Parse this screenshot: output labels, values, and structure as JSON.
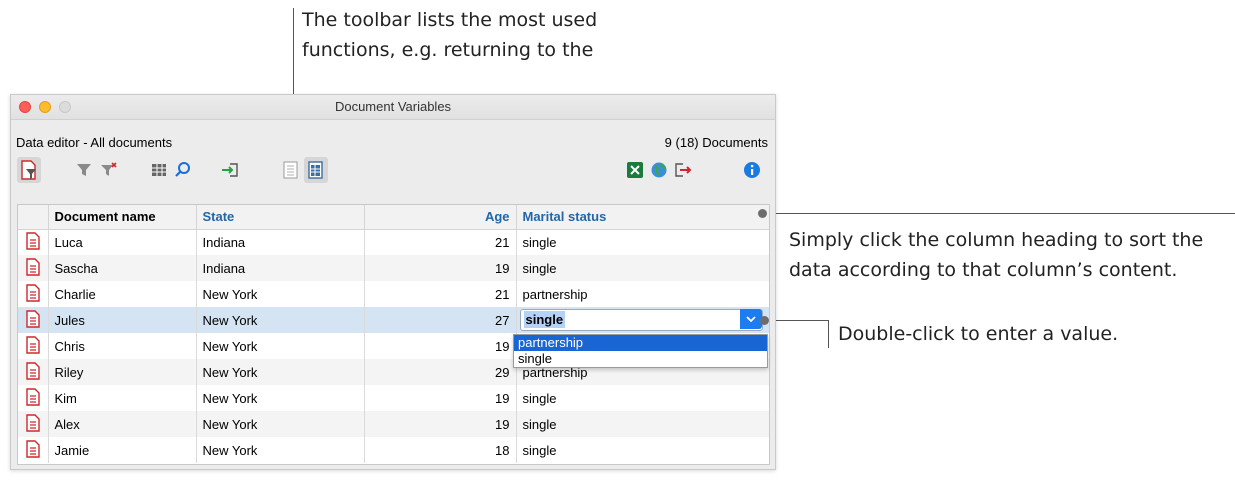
{
  "callouts": {
    "toolbar_line1": "The toolbar lists the most used",
    "toolbar_line2": "functions, e.g. returning to the",
    "sort_line1": "Simply click the column heading to sort the",
    "sort_line2": "data according to that column’s content.",
    "double_click": "Double-click to enter a value."
  },
  "window": {
    "title": "Document Variables",
    "info_left": "Data editor - All documents",
    "info_right": "9 (18) Documents"
  },
  "toolbar": {
    "icons": [
      "filter-document-icon",
      "filter-icon",
      "clear-filter-icon",
      "columns-icon",
      "search-icon",
      "import-icon",
      "list-view-icon",
      "table-view-icon",
      "excel-export-icon",
      "web-export-icon",
      "export-icon",
      "info-icon"
    ]
  },
  "table": {
    "headers": {
      "name": "Document name",
      "state": "State",
      "age": "Age",
      "marital": "Marital status"
    },
    "rows": [
      {
        "name": "Luca",
        "state": "Indiana",
        "age": "21",
        "marital": "single"
      },
      {
        "name": "Sascha",
        "state": "Indiana",
        "age": "19",
        "marital": "single"
      },
      {
        "name": "Charlie",
        "state": "New York",
        "age": "21",
        "marital": "partnership"
      },
      {
        "name": "Jules",
        "state": "New York",
        "age": "27",
        "marital": "single"
      },
      {
        "name": "Chris",
        "state": "New York",
        "age": "19",
        "marital": ""
      },
      {
        "name": "Riley",
        "state": "New York",
        "age": "29",
        "marital": "partnership"
      },
      {
        "name": "Kim",
        "state": "New York",
        "age": "19",
        "marital": "single"
      },
      {
        "name": "Alex",
        "state": "New York",
        "age": "19",
        "marital": "single"
      },
      {
        "name": "Jamie",
        "state": "New York",
        "age": "18",
        "marital": "single"
      }
    ]
  },
  "dropdown": {
    "options": [
      "partnership",
      "single"
    ],
    "highlighted": "partnership"
  },
  "colors": {
    "accent": "#1c7cf0",
    "highlight": "#1865d3",
    "doc_icon": "#d0272d"
  }
}
